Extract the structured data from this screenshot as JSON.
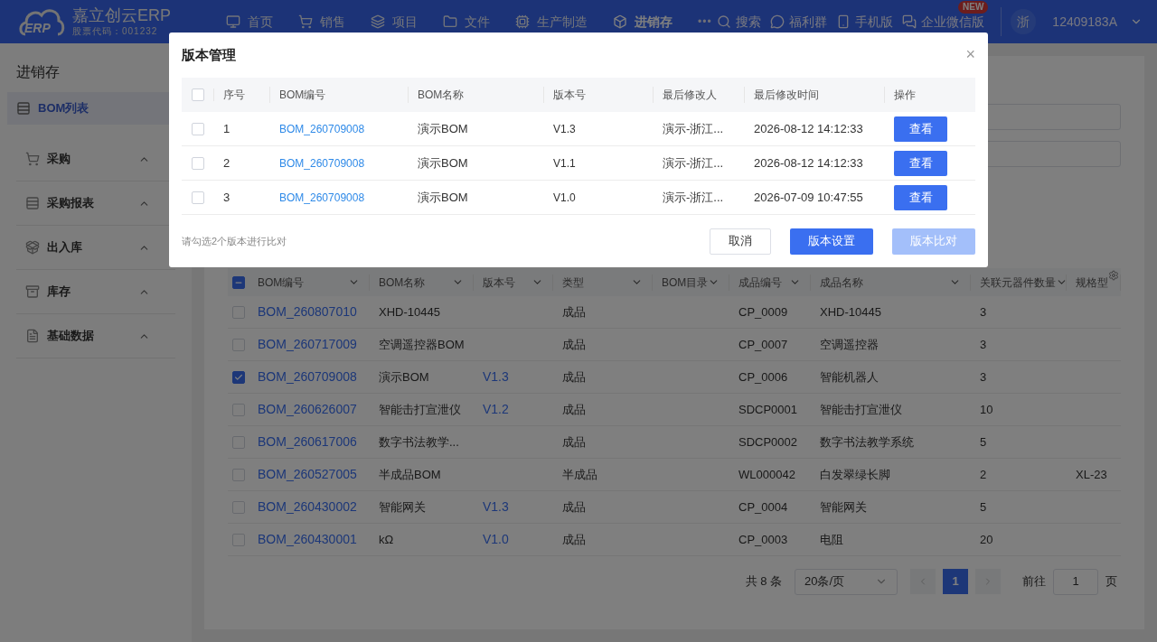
{
  "header": {
    "logo": {
      "mark": "ERP",
      "name": "嘉立创云ERP",
      "stock_code": "股票代码：001232"
    },
    "nav": [
      {
        "label": "首页",
        "selected": false
      },
      {
        "label": "销售",
        "selected": false
      },
      {
        "label": "项目",
        "selected": false
      },
      {
        "label": "文件",
        "selected": false
      },
      {
        "label": "生产制造",
        "selected": false
      },
      {
        "label": "进销存",
        "selected": true
      }
    ],
    "more": "•••",
    "tools": [
      {
        "label": "搜索"
      },
      {
        "label": "福利群"
      },
      {
        "label": "手机版"
      },
      {
        "label": "企业微信版",
        "badge": "NEW"
      }
    ],
    "user": {
      "avatar": "浙",
      "account": "12409183A"
    }
  },
  "sidebar": {
    "title": "进销存",
    "items": [
      {
        "kind": "link",
        "label": "BOM列表",
        "selected": true
      },
      {
        "kind": "group",
        "label": "采购",
        "selected": false
      },
      {
        "kind": "group",
        "label": "采购报表",
        "selected": false
      },
      {
        "kind": "group",
        "label": "出入库",
        "selected": false
      },
      {
        "kind": "group",
        "label": "库存",
        "selected": false
      },
      {
        "kind": "group",
        "label": "基础数据",
        "selected": false
      }
    ]
  },
  "table": {
    "all_indeterminate": true,
    "columns": [
      "BOM编号",
      "BOM名称",
      "版本号",
      "类型",
      "BOM目录",
      "成品编号",
      "成品名称",
      "关联元器件数量",
      "规格型"
    ],
    "rows": [
      {
        "checked": false,
        "cells": [
          "BOM_260807010",
          "XHD-10445",
          "",
          "成品",
          "",
          "CP_0009",
          "XHD-10445",
          "3",
          ""
        ]
      },
      {
        "checked": false,
        "cells": [
          "BOM_260717009",
          "空调遥控器BOM",
          "",
          "成品",
          "",
          "CP_0007",
          "空调遥控器",
          "3",
          ""
        ]
      },
      {
        "checked": true,
        "cells": [
          "BOM_260709008",
          "演示BOM",
          "V1.3",
          "成品",
          "",
          "CP_0006",
          "智能机器人",
          "3",
          ""
        ]
      },
      {
        "checked": false,
        "cells": [
          "BOM_260626007",
          "智能击打宣泄仪",
          "V1.2",
          "成品",
          "",
          "SDCP0001",
          "智能击打宣泄仪",
          "10",
          ""
        ]
      },
      {
        "checked": false,
        "cells": [
          "BOM_260617006",
          "数字书法教学...",
          "",
          "成品",
          "",
          "SDCP0002",
          "数字书法教学系统",
          "5",
          ""
        ]
      },
      {
        "checked": false,
        "cells": [
          "BOM_260527005",
          "半成品BOM",
          "",
          "半成品",
          "",
          "WL000042",
          "白发翠绿长脚",
          "2",
          "XL-23"
        ]
      },
      {
        "checked": false,
        "cells": [
          "BOM_260430002",
          "智能网关",
          "V1.3",
          "成品",
          "",
          "CP_0004",
          "智能网关",
          "5",
          ""
        ]
      },
      {
        "checked": false,
        "cells": [
          "BOM_260430001",
          "kΩ",
          "V1.0",
          "成品",
          "",
          "CP_0003",
          "电阻",
          "20",
          ""
        ]
      }
    ]
  },
  "pagination": {
    "total": "共 8 条",
    "page_size": "20条/页",
    "pages": [
      {
        "label": "1",
        "selected": true
      }
    ],
    "goto_label": "前往",
    "goto_value": "1",
    "goto_suffix": "页"
  },
  "dialog": {
    "title": "版本管理",
    "close": "×",
    "all_checked": false,
    "columns": [
      "序号",
      "BOM编号",
      "BOM名称",
      "版本号",
      "最后修改人",
      "最后修改时间",
      "操作"
    ],
    "rows": [
      {
        "checked": false,
        "index": "1",
        "code": "BOM_260709008",
        "name": "演示BOM",
        "version": "V1.3",
        "editor": "演示-浙江...",
        "time": "2026-08-12 14:12:33",
        "action": "查看"
      },
      {
        "checked": false,
        "index": "2",
        "code": "BOM_260709008",
        "name": "演示BOM",
        "version": "V1.1",
        "editor": "演示-浙江...",
        "time": "2026-08-12 14:12:33",
        "action": "查看"
      },
      {
        "checked": false,
        "index": "3",
        "code": "BOM_260709008",
        "name": "演示BOM",
        "version": "V1.0",
        "editor": "演示-浙江...",
        "time": "2026-07-09 10:47:55",
        "action": "查看"
      }
    ],
    "hint": "请勾选2个版本进行比对",
    "buttons": [
      {
        "kind": "plain",
        "label": "取消",
        "disabled": false
      },
      {
        "kind": "primary",
        "label": "版本设置",
        "disabled": false
      },
      {
        "kind": "primary",
        "label": "版本比对",
        "disabled": true
      }
    ]
  }
}
